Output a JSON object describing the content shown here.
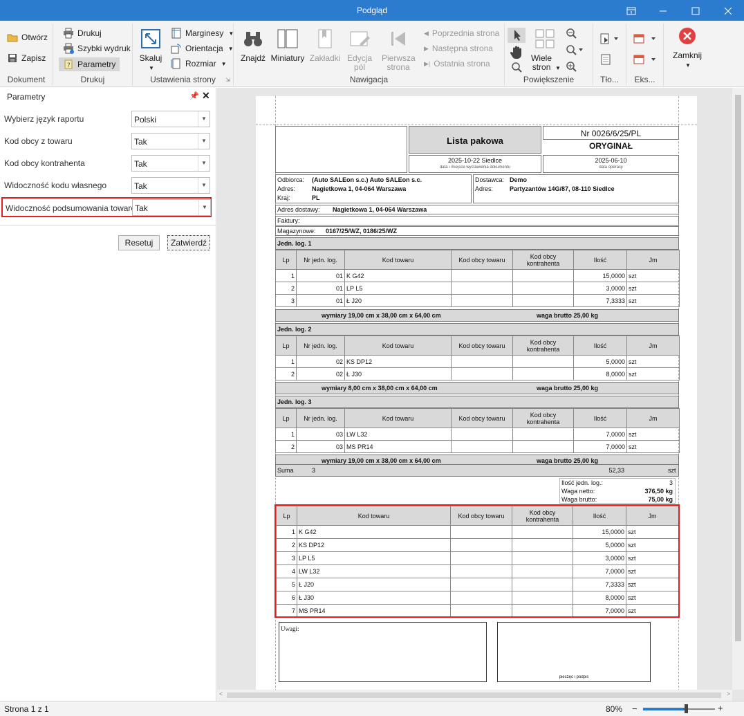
{
  "window": {
    "title": "Podgląd"
  },
  "ribbon": {
    "groups": {
      "dokument": "Dokument",
      "drukuj": "Drukuj",
      "ustawienia": "Ustawienia strony",
      "nawigacja": "Nawigacja",
      "powiekszenie": "Powiększenie",
      "tlo": "Tło...",
      "eks": "Eks..."
    },
    "otworz": "Otwórz",
    "zapisz": "Zapisz",
    "drukuj": "Drukuj",
    "szybki_wydruk": "Szybki wydruk",
    "parametry": "Parametry",
    "skaluj": "Skaluj",
    "marginesy": "Marginesy",
    "orientacja": "Orientacja",
    "rozmiar": "Rozmiar",
    "znajdz": "Znajdź",
    "miniatury": "Miniatury",
    "zakladki": "Zakładki",
    "edycja_pol": "Edycja pól",
    "pierwsza_strona": "Pierwsza strona",
    "poprzednia_strona": "Poprzednia strona",
    "nastepna_strona": "Następna strona",
    "ostatnia_strona": "Ostatnia strona",
    "wiele_stron": "Wiele stron",
    "zamknij": "Zamknij"
  },
  "params_panel": {
    "title": "Parametry",
    "rows": [
      {
        "label": "Wybierz język raportu",
        "value": "Polski"
      },
      {
        "label": "Kod obcy z towaru",
        "value": "Tak"
      },
      {
        "label": "Kod obcy kontrahenta",
        "value": "Tak"
      },
      {
        "label": "Widoczność kodu własnego",
        "value": "Tak"
      },
      {
        "label": "Widoczność podsumowania towarów",
        "value": "Tak"
      }
    ],
    "reset_label": "Resetuj",
    "confirm_label": "Zatwierdź"
  },
  "report": {
    "title": "Lista pakowa",
    "number": "Nr 0026/6/25/PL",
    "original": "ORYGINAŁ",
    "issue_place_date": "2025-10-22 Siedlce",
    "issue_place_date_caption": "data i miejsce wystawienia dokumentu",
    "op_date": "2025-06-10",
    "op_date_caption": "data operacji",
    "odbiorca_label": "Odbiorca:",
    "odbiorca": "(Auto SALEon s.c.) Auto SALEon s.c.",
    "adres_label": "Adres:",
    "odbiorca_adres": "Nagietkowa 1, 04-064 Warszawa",
    "kraj_label": "Kraj:",
    "kraj": "PL",
    "dostawca_label": "Dostawca:",
    "dostawca": "Demo",
    "dostawca_adres": "Partyzantów 14G/87, 08-110 Siedlce",
    "adres_dostawy_label": "Adres dostawy:",
    "adres_dostawy": "Nagietkowa 1, 04-064 Warszawa",
    "faktury_label": "Faktury:",
    "magazynowe_label": "Magazynowe:",
    "magazynowe": "0167/25/WZ, 0186/25/WZ",
    "columns": {
      "lp": "Lp",
      "nr_jedn": "Nr jedn. log.",
      "kod": "Kod towaru",
      "kod_obcy_towaru": "Kod obcy towaru",
      "kod_obcy_kontrahenta": "Kod obcy kontrahenta",
      "ilosc": "Ilość",
      "jm": "Jm"
    },
    "units": [
      {
        "header": "Jedn. log. 1",
        "rows": [
          {
            "lp": "1",
            "nr": "01",
            "kod": "K G42",
            "ilosc": "15,0000",
            "jm": "szt"
          },
          {
            "lp": "2",
            "nr": "01",
            "kod": "LP L5",
            "ilosc": "3,0000",
            "jm": "szt"
          },
          {
            "lp": "3",
            "nr": "01",
            "kod": "Ł J20",
            "ilosc": "7,3333",
            "jm": "szt"
          }
        ],
        "wymiary": "wymiary 19,00 cm x 38,00 cm x 64,00 cm",
        "waga": "waga brutto 25,00 kg"
      },
      {
        "header": "Jedn. log. 2",
        "rows": [
          {
            "lp": "1",
            "nr": "02",
            "kod": "KS DP12",
            "ilosc": "5,0000",
            "jm": "szt"
          },
          {
            "lp": "2",
            "nr": "02",
            "kod": "Ł J30",
            "ilosc": "8,0000",
            "jm": "szt"
          }
        ],
        "wymiary": "wymiary 8,00 cm x 38,00 cm x 64,00 cm",
        "waga": "waga brutto 25,00 kg"
      },
      {
        "header": "Jedn. log. 3",
        "rows": [
          {
            "lp": "1",
            "nr": "03",
            "kod": "LW L32",
            "ilosc": "7,0000",
            "jm": "szt"
          },
          {
            "lp": "2",
            "nr": "03",
            "kod": "MS PR14",
            "ilosc": "7,0000",
            "jm": "szt"
          }
        ],
        "wymiary": "wymiary 19,00 cm x 38,00 cm x 64,00 cm",
        "waga": "waga brutto 25,00 kg"
      }
    ],
    "suma_label": "Suma",
    "suma_count": "3",
    "suma_qty": "52,33",
    "suma_jm": "szt",
    "totals": [
      {
        "label": "Ilość jedn. log.:",
        "value": "3"
      },
      {
        "label": "Waga netto:",
        "value": "376,50 kg"
      },
      {
        "label": "Waga brutto:",
        "value": "75,00 kg"
      }
    ],
    "summary_rows": [
      {
        "lp": "1",
        "kod": "K G42",
        "ilosc": "15,0000",
        "jm": "szt"
      },
      {
        "lp": "2",
        "kod": "KS DP12",
        "ilosc": "5,0000",
        "jm": "szt"
      },
      {
        "lp": "3",
        "kod": "LP L5",
        "ilosc": "3,0000",
        "jm": "szt"
      },
      {
        "lp": "4",
        "kod": "LW L32",
        "ilosc": "7,0000",
        "jm": "szt"
      },
      {
        "lp": "5",
        "kod": "Ł J20",
        "ilosc": "7,3333",
        "jm": "szt"
      },
      {
        "lp": "6",
        "kod": "Ł J30",
        "ilosc": "8,0000",
        "jm": "szt"
      },
      {
        "lp": "7",
        "kod": "MS PR14",
        "ilosc": "7,0000",
        "jm": "szt"
      }
    ],
    "uwagi_label": "Uwagi:",
    "stamp_label": "pieczęć i podpis"
  },
  "status": {
    "page": "Strona 1 z 1",
    "zoom": "80%",
    "zoom_fraction": 0.6
  },
  "colors": {
    "titlebar": "#2b7bcf",
    "highlight": "#e02020",
    "header_gray": "#d9d9d9"
  }
}
